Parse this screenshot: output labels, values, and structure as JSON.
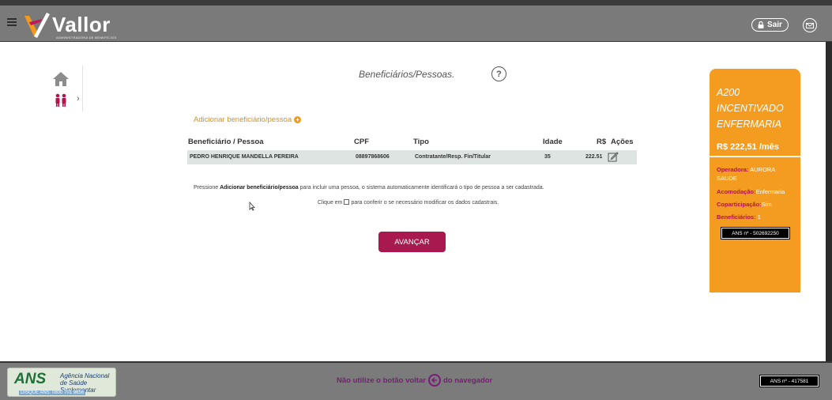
{
  "header": {
    "brand": "Vallor",
    "brand_sub": "ADMINISTRADORA DE BENEFÍCIOS",
    "logout_label": "Sair",
    "icons": [
      "menu-icon",
      "lock-icon",
      "mail-icon"
    ]
  },
  "sidebar": {
    "items": [
      {
        "icon": "home-icon"
      },
      {
        "icon": "people-icon",
        "chevron": "›"
      }
    ]
  },
  "main": {
    "title": "Beneficiários/Pessoas.",
    "help_label": "?",
    "add_link": "Adicionar beneficiário/pessoa",
    "table": {
      "headers": {
        "name": "Beneficiário / Pessoa",
        "cpf": "CPF",
        "type": "Tipo",
        "age": "Idade",
        "currency": "R$",
        "actions": "Ações"
      },
      "rows": [
        {
          "name": "PEDRO HENRIQUE MANDELLA PEREIRA",
          "cpf": "08897868606",
          "type": "Contratante/Resp. Fin/Titular",
          "age": "35",
          "value": "222.51"
        }
      ]
    },
    "hint_line1_pre": "Pressione ",
    "hint_line1_bold": "Adicionar beneficiário/pessoa",
    "hint_line1_post": " para incluir uma pessoa, o sistema automaticamente identificará o tipo de pessoa a ser cadastrada.",
    "hint_line2_pre": "Clique em",
    "hint_line2_post": " para conferir o se necessário modificar os dados cadastrais.",
    "next_button": "AVANÇAR"
  },
  "plan": {
    "name_lines": [
      "A200",
      "INCENTIVADO",
      "ENFERMARIA"
    ],
    "price": "R$ 222,51 /mês",
    "operadora_label": "Operadora:",
    "operadora_value": " AURORA SAUDE",
    "acomodacao_label": "Acomodação:",
    "acomodacao_value": "Enfermaria",
    "coparticipacao_label": "Coparticipação:",
    "coparticipacao_value": "Sim",
    "beneficiarios_label": "Beneficiários:",
    "beneficiarios_value": "1",
    "ans_number": "ANS nº - 502692250",
    "accent": "#f39c1f"
  },
  "footer": {
    "ans_big": "ANS",
    "ans_name": "Agência Nacional de Saúde Suplementar",
    "ans_phone": "DISQUE ANS: 0800 701 9656",
    "message_pre": "Não utilize o botão voltar",
    "message_post": "do navegador",
    "ans_number": "ANS nº - 417581"
  },
  "colors": {
    "button": "#a8194f",
    "footer_text": "#7a1b78",
    "link": "#d4901d"
  }
}
